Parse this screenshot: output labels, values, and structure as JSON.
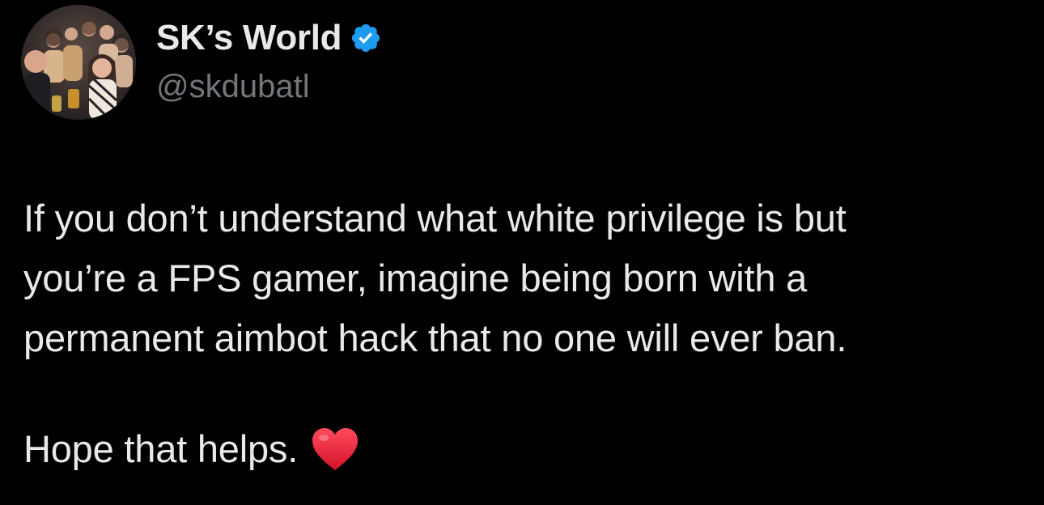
{
  "author": {
    "display_name": "SK’s World",
    "handle": "@skdubatl",
    "verified": true,
    "avatar_icon": "group-photo-avatar",
    "verified_icon": "verified-badge-icon",
    "verified_color": "#1d9bf0"
  },
  "tweet": {
    "lines": [
      "If you don’t understand what white privilege is but",
      "you’re a FPS gamer, imagine being born with a",
      "permanent aimbot hack that no one will ever ban."
    ],
    "closing": "Hope that helps.",
    "closing_icon": "red-heart-icon",
    "heart_color": "#e0182d"
  },
  "theme": {
    "background": "#000000",
    "text": "#e7e9ea",
    "secondary_text": "#71767b"
  }
}
